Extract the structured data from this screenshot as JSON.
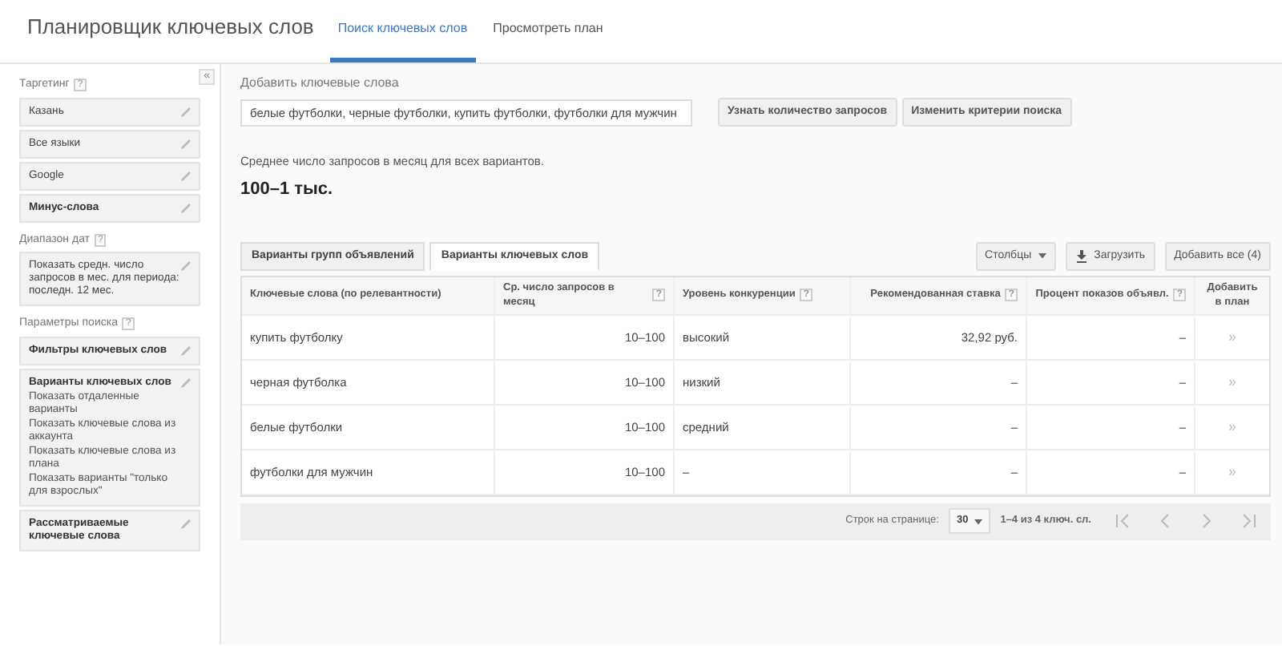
{
  "header": {
    "title": "Планировщик ключевых слов",
    "tabs": [
      {
        "label": "Поиск ключевых слов",
        "selected": true
      },
      {
        "label": "Просмотреть план",
        "selected": false
      }
    ]
  },
  "sidebar": {
    "collapse": "«",
    "sections": [
      {
        "title": "Таргетинг",
        "help": "?",
        "items": [
          {
            "label": "Казань",
            "bold": false
          },
          {
            "label": "Все языки",
            "bold": false
          },
          {
            "label": "Google",
            "bold": false
          },
          {
            "label": "Минус-слова",
            "bold": true
          }
        ]
      },
      {
        "title": "Диапазон дат",
        "help": "?",
        "items": [
          {
            "label": "Показать средн. число запросов в мес. для периода: последн. 12 мес.",
            "bold": false
          }
        ]
      },
      {
        "title": "Параметры поиска",
        "help": "?",
        "items": [
          {
            "label": "Фильтры ключевых слов",
            "bold": true
          },
          {
            "label": "Варианты ключевых слов",
            "bold": true,
            "details": [
              "Показать отдаленные варианты",
              "Показать ключевые слова из аккаунта",
              "Показать ключевые слова из плана",
              "Показать варианты \"только для взрослых\""
            ]
          },
          {
            "label": "Рассматриваемые ключевые слова",
            "bold": true
          }
        ]
      }
    ]
  },
  "add_keywords": {
    "label": "Добавить ключевые слова",
    "value": "белые футболки, черные футболки, купить футболки, футболки для мужчин",
    "buttons": [
      "Узнать количество запросов",
      "Изменить критерии поиска"
    ]
  },
  "summary": {
    "caption": "Среднее число запросов в месяц для всех вариантов.",
    "value": "100–1 тыс."
  },
  "result_tabs": [
    {
      "label": "Варианты групп объявлений",
      "selected": false
    },
    {
      "label": "Варианты ключевых слов",
      "selected": true
    }
  ],
  "actions": [
    {
      "label": "Столбцы",
      "kind": "dropdown"
    },
    {
      "label": "Загрузить",
      "kind": "download"
    },
    {
      "label": "Добавить все (4)",
      "kind": "plain"
    }
  ],
  "table": {
    "columns": [
      {
        "label": "Ключевые слова (по релевантности)"
      },
      {
        "label": "Ср. число запросов в месяц",
        "help": "?"
      },
      {
        "label": "Уровень конкуренции",
        "help": "?"
      },
      {
        "label": "Рекомендованная ставка",
        "help": "?"
      },
      {
        "label": "Процент показов объявл.",
        "help": "?"
      },
      {
        "label": "Добавить в план"
      }
    ],
    "rows": [
      [
        "купить футболку",
        "10–100",
        "высокий",
        "32,92 руб.",
        "–",
        "»"
      ],
      [
        "черная футболка",
        "10–100",
        "низкий",
        "–",
        "–",
        "»"
      ],
      [
        "белые футболки",
        "10–100",
        "средний",
        "–",
        "–",
        "»"
      ],
      [
        "футболки для мужчин",
        "10–100",
        "–",
        "–",
        "–",
        "»"
      ]
    ]
  },
  "pager": {
    "rows_label": "Строк на странице:",
    "page_size": "30",
    "range": "1–4 из 4 ключ. сл."
  }
}
